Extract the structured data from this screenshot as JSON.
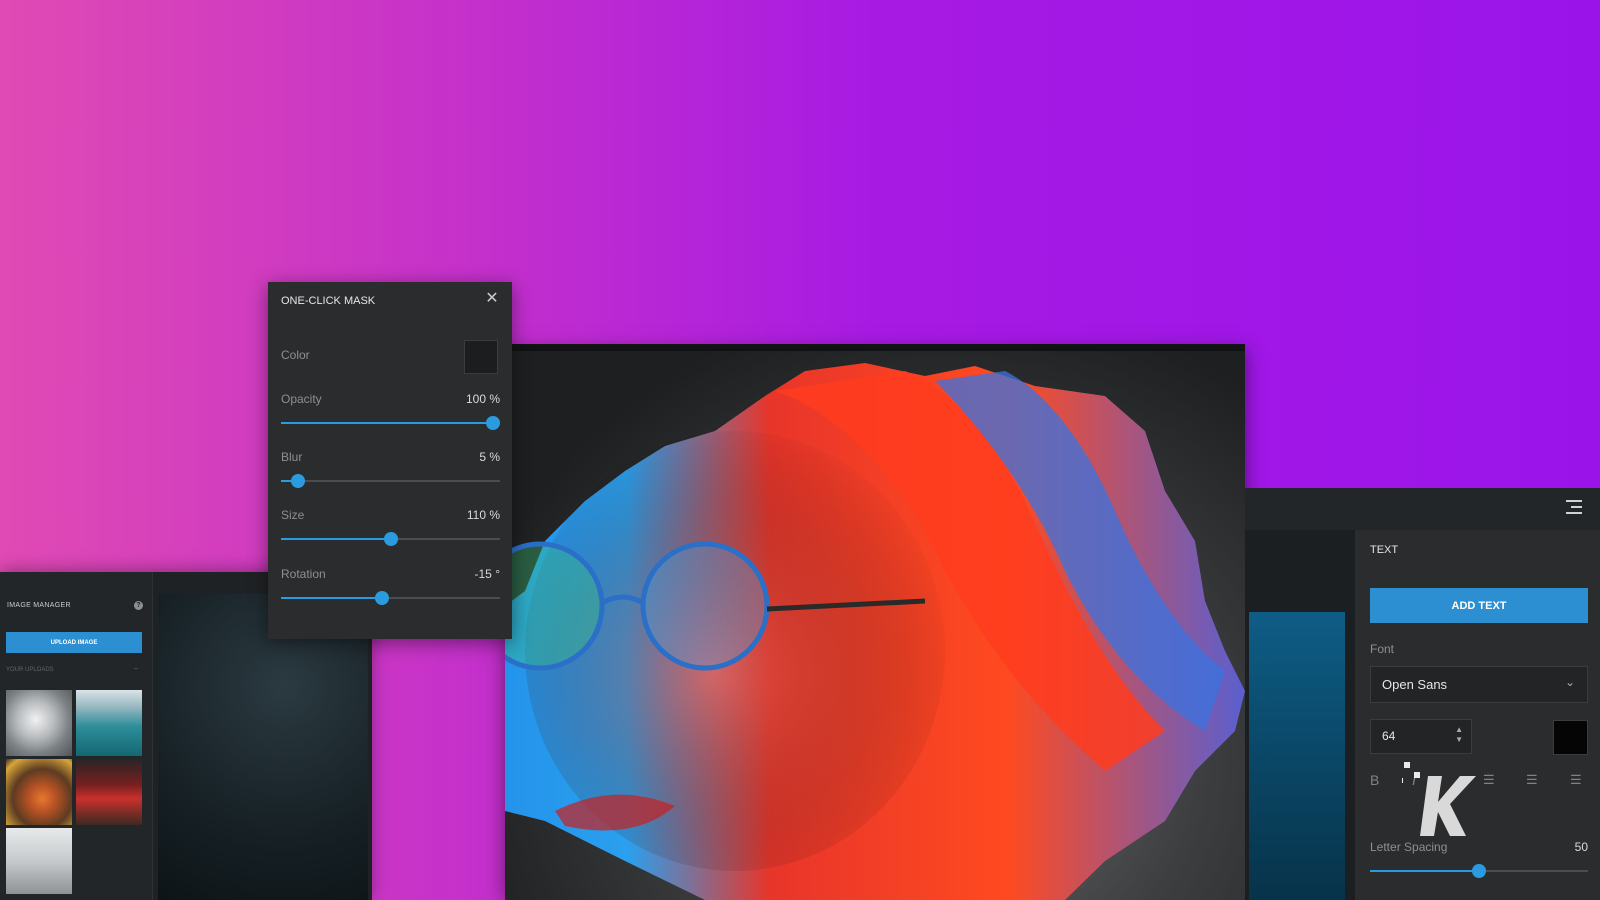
{
  "image_manager": {
    "title": "IMAGE MANAGER",
    "upload_button": "UPLOAD IMAGE",
    "uploads_label": "YOUR UPLOADS"
  },
  "mask_panel": {
    "title": "ONE-CLICK MASK",
    "color_label": "Color",
    "color_value": "#1b1d1f",
    "opacity": {
      "label": "Opacity",
      "display": "100 %",
      "value": 100,
      "min": 0,
      "max": 100
    },
    "blur": {
      "label": "Blur",
      "display": "5 %",
      "value": 5,
      "min": 0,
      "max": 100
    },
    "size": {
      "label": "Size",
      "display": "110 %",
      "value": 110,
      "min": 10,
      "max": 210
    },
    "rotation": {
      "label": "Rotation",
      "display": "-15 °",
      "value": -15,
      "min": -180,
      "max": 180
    }
  },
  "text_panel": {
    "title": "TEXT",
    "add_text_button": "ADD TEXT",
    "font_label": "Font",
    "font_value": "Open Sans",
    "font_size": "64",
    "text_color": "#050505",
    "format": {
      "bold": "B",
      "italic": "I"
    },
    "letter_spacing": {
      "label": "Letter Spacing",
      "display": "50",
      "value": 50,
      "min": 0,
      "max": 100
    }
  },
  "colors": {
    "accent": "#2b9be0",
    "panel": "#2a2c2e"
  }
}
